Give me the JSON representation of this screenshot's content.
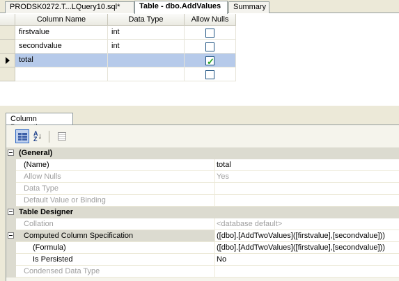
{
  "tabs": [
    {
      "label": "PRODSK0272.T...LQuery10.sql*",
      "active": false
    },
    {
      "label": "Table - dbo.AddValues",
      "active": true
    },
    {
      "label": "Summary",
      "active": false
    }
  ],
  "grid": {
    "headers": [
      "Column Name",
      "Data Type",
      "Allow Nulls"
    ],
    "rows": [
      {
        "name": "firstvalue",
        "type": "int",
        "allow_nulls": false,
        "selected": false
      },
      {
        "name": "secondvalue",
        "type": "int",
        "allow_nulls": false,
        "selected": false
      },
      {
        "name": "total",
        "type": "",
        "allow_nulls": true,
        "selected": true
      },
      {
        "name": "",
        "type": "",
        "allow_nulls": false,
        "selected": false
      }
    ]
  },
  "properties": {
    "tab_label": "Column Properties",
    "toolbar": [
      "categorized-icon",
      "alphabetical-icon",
      "property-pages-icon"
    ],
    "rows": [
      {
        "kind": "category",
        "name": "(General)"
      },
      {
        "kind": "prop",
        "name": "(Name)",
        "value": "total"
      },
      {
        "kind": "disabled",
        "name": "Allow Nulls",
        "value": "Yes"
      },
      {
        "kind": "disabled",
        "name": "Data Type",
        "value": ""
      },
      {
        "kind": "disabled",
        "name": "Default Value or Binding",
        "value": ""
      },
      {
        "kind": "category",
        "name": "Table Designer"
      },
      {
        "kind": "disabled",
        "name": "Collation",
        "value": "<database default>"
      },
      {
        "kind": "expand",
        "name": "Computed Column Specification",
        "value": "([dbo].[AddTwoValues]([firstvalue],[secondvalue]))"
      },
      {
        "kind": "sub",
        "name": "(Formula)",
        "value": "([dbo].[AddTwoValues]([firstvalue],[secondvalue]))"
      },
      {
        "kind": "sub",
        "name": "Is Persisted",
        "value": "No"
      },
      {
        "kind": "disabled",
        "name": "Condensed Data Type",
        "value": ""
      }
    ]
  }
}
